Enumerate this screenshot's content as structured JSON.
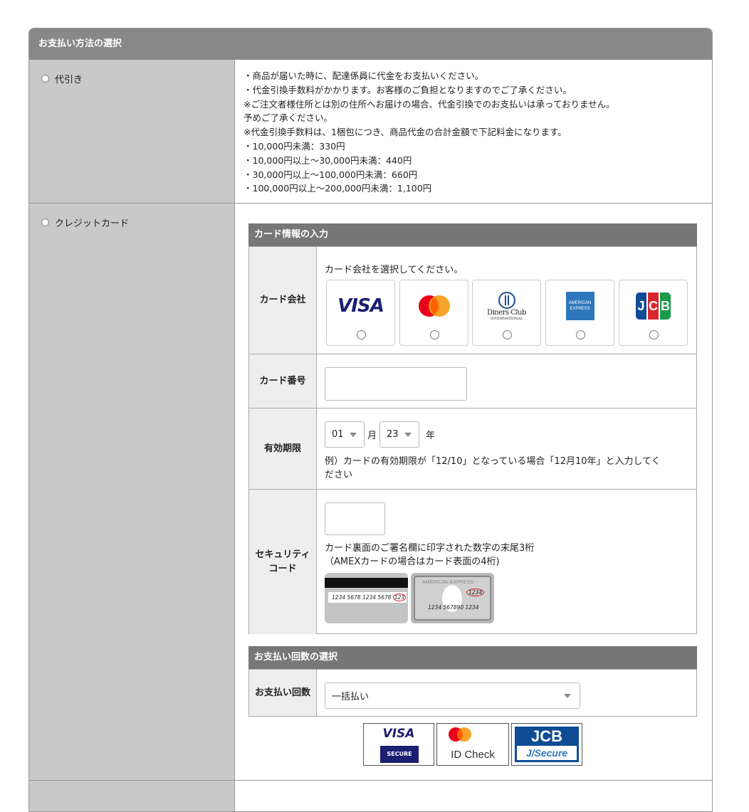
{
  "section_title": "お支払い方法の選択",
  "cod": {
    "label": "代引き",
    "lines": [
      "・商品が届いた時に、配達係員に代金をお支払いください。",
      "・代金引換手数料がかかります。お客様のご負担となりますのでご了承ください。",
      "※ご注文者様住所とは別の住所へお届けの場合、代金引換でのお支払いは承っておりません。",
      "予めご了承ください。",
      "※代金引換手数料は、1梱包につき、商品代金の合計金額で下記料金になります。",
      "・10,000円未満：330円",
      "・10,000円以上～30,000円未満：440円",
      "・30,000円以上～100,000円未満：660円",
      "・100,000円以上～200,000円未満：1,100円"
    ]
  },
  "credit": {
    "label": "クレジットカード",
    "card_info_title": "カード情報の入力",
    "company": {
      "label": "カード会社",
      "prompt": "カード会社を選択してください。",
      "brands": [
        {
          "name": "VISA",
          "icon": "visa-logo"
        },
        {
          "name": "Mastercard",
          "icon": "mastercard-logo"
        },
        {
          "name": "Diners Club",
          "icon": "diners-club-logo",
          "text1": "Diners Club",
          "text2": "INTERNATIONAL"
        },
        {
          "name": "American Express",
          "icon": "amex-logo",
          "text1": "AMERICAN",
          "text2": "EXPRESS"
        },
        {
          "name": "JCB",
          "icon": "jcb-logo",
          "text": "JCB"
        }
      ]
    },
    "number": {
      "label": "カード番号",
      "value": ""
    },
    "expiry": {
      "label": "有効期限",
      "month": "01",
      "month_unit": "月",
      "year": "23",
      "year_unit": "年",
      "note": "例）カードの有効期限が「12/10」となっている場合「12月10年」と入力してく",
      "note2": "ださい"
    },
    "security": {
      "label1": "セキュリティ",
      "label2": "コード",
      "value": "",
      "note1": "カード裏面のご署名欄に印字された数字の末尾3桁",
      "note2": "（AMEXカードの場合はカード表面の4桁)",
      "back_card_number": "1234 5678 1234 5678",
      "back_card_cvv": "123",
      "amex_brand": "AMERICAN EXPRESS",
      "amex_cvv": "1234",
      "amex_number": "1234 567890 1234"
    },
    "installments_title": "お支払い回数の選択",
    "installments": {
      "label": "お支払い回数",
      "value": "一括払い"
    },
    "badges": {
      "visa_secure_top": "VISA",
      "visa_secure_bottom": "SECURE",
      "id_check": "ID Check",
      "jcb_top": "JCB",
      "jcb_bottom": "J/Secure"
    }
  },
  "colors": {
    "header_bg": "#888888",
    "left_col_bg": "#c9c9c9",
    "visa_blue": "#1a1f71",
    "mc_red": "#eb001b",
    "mc_orange": "#f79e1b",
    "amex_blue": "#2e77bc",
    "jcb_blue": "#0e4c96",
    "jcb_red": "#d7282f",
    "jcb_green": "#1b9a4b"
  }
}
